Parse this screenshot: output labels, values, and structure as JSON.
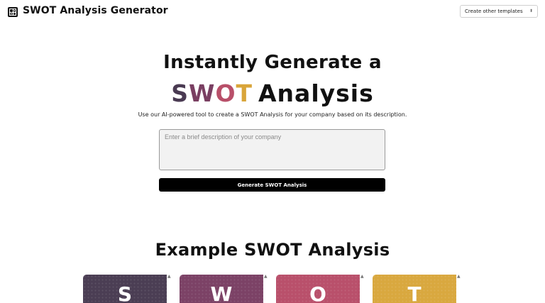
{
  "header": {
    "app_title": "SWOT Analysis Generator",
    "template_select": {
      "selected": "Create other templates"
    }
  },
  "hero": {
    "line1": "Instantly Generate a",
    "letters": {
      "s": "S",
      "w": "W",
      "o": "O",
      "t": "T"
    },
    "word": "Analysis",
    "subtitle": "Use our AI-powered tool to create a SWOT Analysis for your company based on its description."
  },
  "form": {
    "description_value": "",
    "description_placeholder": "Enter a brief description of your company",
    "generate_label": "Generate SWOT Analysis"
  },
  "examples": {
    "title": "Example SWOT Analysis",
    "cards": [
      "S",
      "W",
      "O",
      "T"
    ]
  },
  "colors": {
    "s": "#4b3e54",
    "w": "#7c4266",
    "o": "#b9506b",
    "t": "#d9a83f",
    "button": "#000000"
  }
}
